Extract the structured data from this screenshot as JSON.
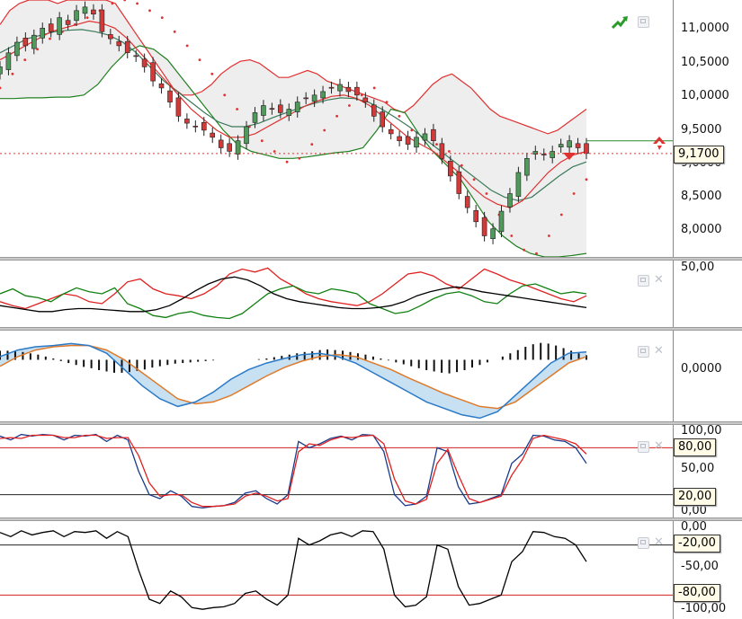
{
  "price_pane": {
    "axis_ticks": [
      "11,0000",
      "10,5000",
      "10,0000",
      "9,5000",
      "9,0000",
      "8,5000",
      "8,0000"
    ],
    "current_label": "9,1700",
    "colors": {
      "bull": "#4f9a5a",
      "bear": "#d23a3a",
      "band_upper": "#e03030",
      "band_lower": "#208020",
      "ma_fast": "#e03030",
      "ma_slow": "#3a7a5a",
      "sar": "#e03030",
      "band_fill": "#eeeeee"
    }
  },
  "osc1_pane": {
    "axis_ticks": [
      "50,00"
    ]
  },
  "macd_pane": {
    "axis_ticks": [
      "0,0000"
    ]
  },
  "stoch_pane": {
    "axis_ticks": [
      "100,00",
      "50,00",
      "0,00"
    ],
    "level_labels": [
      "80,00",
      "20,00"
    ]
  },
  "willr_pane": {
    "axis_ticks": [
      "0,00",
      "-50,00",
      "-100,00"
    ],
    "level_labels": [
      "-20,00",
      "-80,00"
    ]
  },
  "icons": {
    "trend": "trend-arrow-icon",
    "buy_sell": "buy-sell-arrows-icon",
    "restore": "restore-icon",
    "close": "close-icon"
  },
  "chart_data": [
    {
      "type": "candlestick",
      "ylim": [
        7.7,
        11.35
      ],
      "current_value": 9.17,
      "close": [
        10.4,
        10.6,
        10.75,
        10.7,
        10.85,
        10.95,
        10.9,
        11.1,
        11.0,
        11.2,
        11.25,
        11.15,
        10.9,
        10.8,
        10.7,
        10.6,
        10.55,
        10.4,
        10.2,
        10.1,
        9.9,
        9.7,
        9.6,
        9.55,
        9.5,
        9.4,
        9.25,
        9.2,
        9.35,
        9.55,
        9.75,
        9.85,
        9.8,
        9.75,
        9.8,
        9.9,
        9.95,
        10.0,
        10.05,
        10.1,
        10.15,
        10.05,
        10.0,
        9.9,
        9.7,
        9.55,
        9.45,
        9.35,
        9.3,
        9.4,
        9.45,
        9.35,
        9.1,
        8.85,
        8.6,
        8.4,
        8.2,
        8.0,
        8.1,
        8.35,
        8.6,
        8.9,
        9.1,
        9.2,
        9.15,
        9.2,
        9.3,
        9.35,
        9.25,
        9.17
      ],
      "upper_band": [
        11.0,
        11.2,
        11.3,
        11.35,
        11.35,
        11.35,
        11.3,
        11.35,
        11.35,
        11.35,
        11.35,
        11.35,
        11.3,
        11.1,
        10.9,
        10.7,
        10.5,
        10.3,
        10.1,
        10.0,
        10.0,
        10.05,
        10.15,
        10.3,
        10.4,
        10.48,
        10.5,
        10.45,
        10.35,
        10.25,
        10.25,
        10.3,
        10.35,
        10.3,
        10.2,
        10.15,
        10.1,
        10.05,
        10.0,
        9.95,
        9.9,
        9.8,
        9.75,
        9.85,
        10.0,
        10.15,
        10.25,
        10.3,
        10.2,
        10.1,
        9.95,
        9.8,
        9.7,
        9.65,
        9.6,
        9.55,
        9.5,
        9.45,
        9.5,
        9.6,
        9.7,
        9.8
      ],
      "lower_band": [
        9.95,
        9.95,
        9.96,
        9.96,
        9.97,
        9.97,
        10.0,
        10.15,
        10.4,
        10.6,
        10.7,
        10.65,
        10.5,
        10.25,
        10.0,
        9.75,
        9.5,
        9.3,
        9.2,
        9.15,
        9.1,
        9.1,
        9.12,
        9.15,
        9.18,
        9.2,
        9.25,
        9.5,
        9.8,
        9.75,
        9.45,
        9.2,
        9.0,
        8.8,
        8.5,
        8.2,
        8.0,
        7.85,
        7.75,
        7.7,
        7.7,
        7.72,
        7.75
      ],
      "ma_fast": [
        10.5,
        10.6,
        10.7,
        10.8,
        10.9,
        10.95,
        11.0,
        11.05,
        11.02,
        10.95,
        10.8,
        10.6,
        10.4,
        10.2,
        10.0,
        9.8,
        9.65,
        9.5,
        9.4,
        9.4,
        9.45,
        9.55,
        9.65,
        9.75,
        9.85,
        9.92,
        9.98,
        10.0,
        9.95,
        9.85,
        9.7,
        9.55,
        9.4,
        9.3,
        9.2,
        9.05,
        8.9,
        8.7,
        8.55,
        8.45,
        8.4,
        8.5,
        8.7,
        8.9,
        9.05,
        9.15,
        9.2
      ],
      "ma_slow": [
        10.6,
        10.7,
        10.8,
        10.85,
        10.9,
        10.92,
        10.93,
        10.9,
        10.85,
        10.75,
        10.6,
        10.4,
        10.2,
        10.05,
        9.9,
        9.75,
        9.62,
        9.55,
        9.55,
        9.6,
        9.68,
        9.75,
        9.82,
        9.88,
        9.93,
        9.96,
        9.95,
        9.9,
        9.8,
        9.68,
        9.55,
        9.4,
        9.25,
        9.1,
        8.95,
        8.8,
        8.65,
        8.55,
        8.5,
        8.55,
        8.7,
        8.85,
        8.98,
        9.05
      ],
      "sar": [
        10.1,
        10.3,
        10.5,
        10.65,
        10.8,
        10.9,
        11.0,
        11.1,
        11.2,
        11.3,
        11.35,
        11.3,
        11.2,
        11.1,
        10.9,
        10.7,
        10.5,
        10.3,
        10.0,
        9.8,
        9.55,
        9.35,
        9.2,
        9.05,
        9.1,
        9.3,
        9.5,
        9.7,
        9.85,
        10.0,
        10.1,
        9.9,
        9.7,
        9.5,
        9.4,
        9.3,
        9.2,
        9.0,
        8.8,
        8.6,
        8.3,
        8.0,
        7.8,
        7.75,
        8.0,
        8.3,
        8.6,
        8.8
      ]
    },
    {
      "type": "line",
      "ylim": [
        0,
        60
      ],
      "axis_ticks": [
        50
      ],
      "series": [
        {
          "color": "#e02020",
          "values": [
            22,
            18,
            15,
            20,
            25,
            30,
            28,
            22,
            20,
            30,
            42,
            45,
            35,
            30,
            28,
            25,
            30,
            38,
            50,
            55,
            52,
            56,
            45,
            38,
            30,
            25,
            22,
            20,
            18,
            22,
            30,
            40,
            50,
            52,
            48,
            40,
            35,
            45,
            55,
            50,
            44,
            40,
            35,
            30,
            25,
            22,
            28
          ]
        },
        {
          "color": "#108010",
          "values": [
            30,
            35,
            28,
            26,
            22,
            30,
            36,
            32,
            30,
            36,
            20,
            15,
            8,
            6,
            10,
            12,
            8,
            6,
            5,
            10,
            20,
            30,
            35,
            38,
            32,
            30,
            35,
            33,
            30,
            20,
            15,
            10,
            12,
            18,
            25,
            30,
            32,
            28,
            22,
            20,
            30,
            38,
            40,
            35,
            30,
            32,
            30
          ]
        },
        {
          "color": "#000000",
          "values": [
            18,
            16,
            14,
            12,
            12,
            14,
            15,
            15,
            14,
            13,
            12,
            12,
            14,
            18,
            25,
            33,
            40,
            45,
            47,
            44,
            38,
            30,
            25,
            22,
            20,
            18,
            16,
            15,
            15,
            16,
            18,
            22,
            28,
            32,
            35,
            37,
            35,
            32,
            30,
            28,
            26,
            24,
            22,
            20,
            18,
            16
          ]
        }
      ]
    },
    {
      "type": "macd",
      "ylim": [
        -0.95,
        0.45
      ],
      "axis_ticks": [
        0
      ],
      "macd": [
        0.05,
        0.15,
        0.2,
        0.22,
        0.25,
        0.22,
        0.1,
        -0.15,
        -0.4,
        -0.6,
        -0.72,
        -0.65,
        -0.5,
        -0.3,
        -0.15,
        -0.05,
        0.02,
        0.08,
        0.1,
        0.05,
        -0.05,
        -0.2,
        -0.35,
        -0.5,
        -0.65,
        -0.75,
        -0.85,
        -0.9,
        -0.8,
        -0.55,
        -0.3,
        -0.05,
        0.1,
        0.12
      ],
      "signal": [
        -0.1,
        0.05,
        0.15,
        0.2,
        0.22,
        0.22,
        0.15,
        0.0,
        -0.2,
        -0.4,
        -0.6,
        -0.68,
        -0.65,
        -0.55,
        -0.4,
        -0.25,
        -0.12,
        -0.02,
        0.05,
        0.08,
        0.05,
        -0.05,
        -0.15,
        -0.28,
        -0.4,
        -0.52,
        -0.62,
        -0.72,
        -0.75,
        -0.65,
        -0.45,
        -0.25,
        -0.05,
        0.05
      ],
      "histogram": [
        0.14,
        0.14,
        0.13,
        0.12,
        0.1,
        0.08,
        0.05,
        0.02,
        -0.02,
        -0.05,
        -0.08,
        -0.11,
        -0.13,
        -0.16,
        -0.18,
        -0.2,
        -0.2,
        -0.19,
        -0.17,
        -0.15,
        -0.12,
        -0.1,
        -0.08,
        -0.06,
        -0.05,
        -0.04,
        -0.03,
        -0.02,
        -0.01,
        0.0,
        0.0,
        0.0,
        0.0,
        0.0,
        0.01,
        0.02,
        0.04,
        0.06,
        0.08,
        0.1,
        0.12,
        0.13,
        0.15,
        0.16,
        0.15,
        0.14,
        0.12,
        0.1,
        0.08,
        0.05,
        0.02,
        -0.01,
        -0.04,
        -0.07,
        -0.1,
        -0.13,
        -0.16,
        -0.18,
        -0.2,
        -0.21,
        -0.19,
        -0.16,
        -0.12,
        -0.08,
        -0.04,
        0.0,
        0.05,
        0.1,
        0.15,
        0.2,
        0.24,
        0.26,
        0.25,
        0.22,
        0.18,
        0.14,
        0.1,
        0.07
      ]
    },
    {
      "type": "line",
      "ylim": [
        0,
        100
      ],
      "axis_ticks": [
        100,
        50,
        0
      ],
      "levels": [
        80,
        20
      ],
      "series": [
        {
          "color": "#1a3a8a",
          "values": [
            95,
            90,
            97,
            95,
            97,
            96,
            90,
            96,
            95,
            97,
            88,
            96,
            90,
            50,
            20,
            15,
            25,
            18,
            5,
            3,
            5,
            6,
            10,
            22,
            25,
            15,
            8,
            20,
            88,
            80,
            85,
            92,
            95,
            90,
            97,
            96,
            75,
            20,
            6,
            8,
            18,
            80,
            75,
            30,
            8,
            10,
            15,
            20,
            60,
            72,
            96,
            95,
            90,
            88,
            80,
            60
          ]
        },
        {
          "color": "#e02020",
          "values": [
            92,
            93,
            92,
            96,
            96,
            96,
            93,
            93,
            96,
            96,
            92,
            93,
            93,
            70,
            35,
            18,
            20,
            20,
            10,
            5,
            5,
            6,
            8,
            18,
            22,
            18,
            12,
            15,
            75,
            85,
            83,
            90,
            94,
            93,
            95,
            96,
            85,
            40,
            12,
            8,
            14,
            60,
            78,
            45,
            15,
            10,
            14,
            18,
            45,
            65,
            92,
            96,
            93,
            90,
            85,
            72
          ]
        }
      ]
    },
    {
      "type": "line",
      "ylim": [
        -100,
        0
      ],
      "axis_ticks": [
        0,
        -50,
        -100
      ],
      "levels": [
        -20,
        -80
      ],
      "series": [
        {
          "color": "#000000",
          "values": [
            -5,
            -10,
            -3,
            -8,
            -5,
            -3,
            -10,
            -4,
            -5,
            -3,
            -12,
            -4,
            -10,
            -50,
            -85,
            -90,
            -75,
            -82,
            -95,
            -97,
            -95,
            -94,
            -90,
            -78,
            -75,
            -85,
            -92,
            -80,
            -12,
            -20,
            -15,
            -8,
            -5,
            -10,
            -3,
            -4,
            -25,
            -80,
            -94,
            -92,
            -82,
            -20,
            -25,
            -70,
            -92,
            -90,
            -85,
            -80,
            -40,
            -28,
            -4,
            -5,
            -10,
            -12,
            -20,
            -40
          ]
        }
      ]
    }
  ]
}
